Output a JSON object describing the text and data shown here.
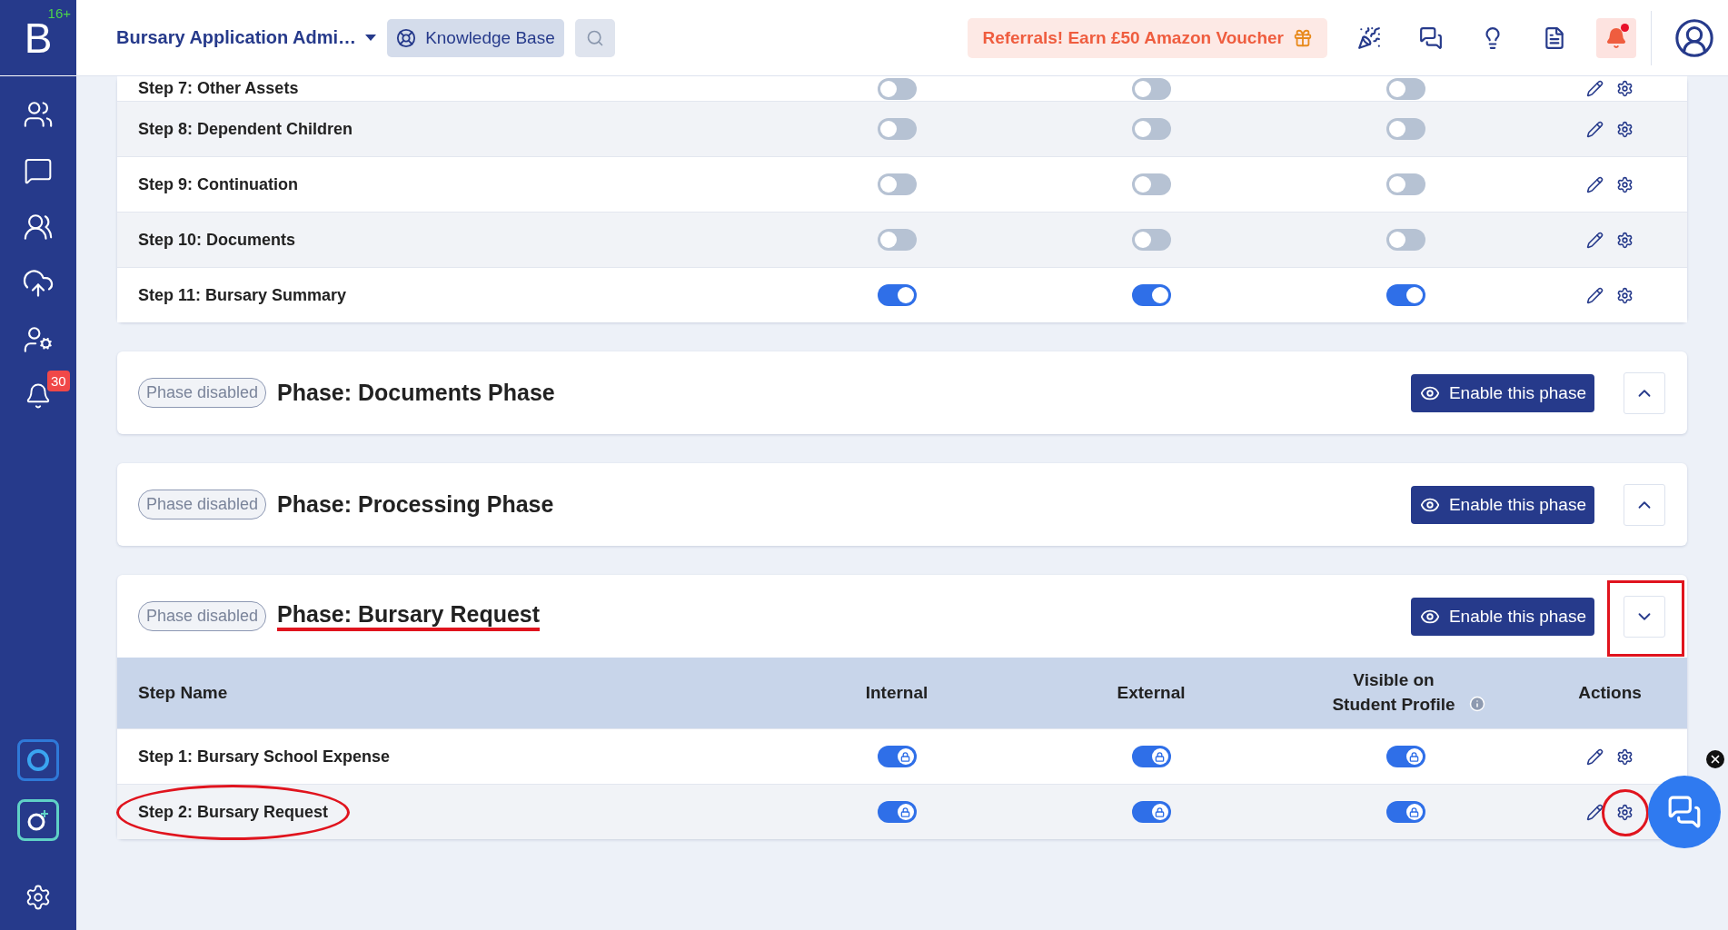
{
  "header": {
    "logo": "B",
    "logo_badge": "16+",
    "title": "Bursary Application Admi…",
    "knowledge_base": "Knowledge Base",
    "referral": "Referrals! Earn £50 Amazon Voucher",
    "notifications_unread": true
  },
  "sidebar": {
    "notification_count": "30"
  },
  "top_card": {
    "rows": [
      {
        "name": "Step 7: Other Assets",
        "toggles": [
          {
            "on": false,
            "locked": false
          },
          {
            "on": false,
            "locked": false
          },
          {
            "on": false,
            "locked": false
          }
        ]
      },
      {
        "name": "Step 8: Dependent Children",
        "toggles": [
          {
            "on": false,
            "locked": false
          },
          {
            "on": false,
            "locked": false
          },
          {
            "on": false,
            "locked": false
          }
        ]
      },
      {
        "name": "Step 9: Continuation",
        "toggles": [
          {
            "on": false,
            "locked": false
          },
          {
            "on": false,
            "locked": false
          },
          {
            "on": false,
            "locked": false
          }
        ]
      },
      {
        "name": "Step 10: Documents",
        "toggles": [
          {
            "on": false,
            "locked": false
          },
          {
            "on": false,
            "locked": false
          },
          {
            "on": false,
            "locked": false
          }
        ]
      },
      {
        "name": "Step 11: Bursary Summary",
        "toggles": [
          {
            "on": true,
            "locked": false
          },
          {
            "on": true,
            "locked": false
          },
          {
            "on": true,
            "locked": false
          }
        ]
      }
    ]
  },
  "phases": [
    {
      "badge": "Phase disabled",
      "title": "Phase: Documents Phase",
      "button": "Enable this phase",
      "expanded": false,
      "title_marked": false,
      "toggle_marked": false
    },
    {
      "badge": "Phase disabled",
      "title": "Phase: Processing Phase",
      "button": "Enable this phase",
      "expanded": false,
      "title_marked": false,
      "toggle_marked": false
    },
    {
      "badge": "Phase disabled",
      "title": "Phase: Bursary Request",
      "button": "Enable this phase",
      "expanded": true,
      "title_marked": true,
      "toggle_marked": true,
      "columns": [
        "Step Name",
        "Internal",
        "External",
        "Visible on Student Profile",
        "Actions"
      ],
      "rows": [
        {
          "name": "Step 1: Bursary School Expense",
          "name_marked": false,
          "settings_marked": false,
          "toggles": [
            {
              "on": true,
              "locked": true
            },
            {
              "on": true,
              "locked": true
            },
            {
              "on": true,
              "locked": true
            }
          ]
        },
        {
          "name": "Step 2: Bursary Request",
          "name_marked": true,
          "settings_marked": true,
          "toggles": [
            {
              "on": true,
              "locked": true
            },
            {
              "on": true,
              "locked": true
            },
            {
              "on": true,
              "locked": true
            }
          ]
        }
      ]
    }
  ]
}
